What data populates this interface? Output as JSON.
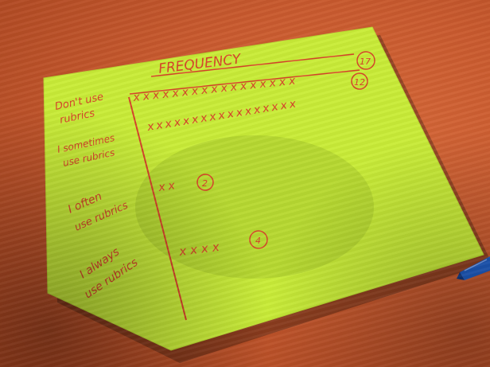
{
  "colors": {
    "table": "#c95a2e",
    "paper": "#c9ec38",
    "ink": "#d8432a",
    "pen": "#1f5fc8"
  },
  "sheet": {
    "header": "FREQUENCY",
    "rows": [
      {
        "label_line1": "Don't use",
        "label_line2": "rubrics",
        "marks": "xxxxxxxxxxxxxxxxx",
        "count": "17"
      },
      {
        "label_line1": "I sometimes",
        "label_line2": "use rubrics",
        "marks": "xxxxxxxxxxxxxxxxx",
        "count": "12"
      },
      {
        "label_line1": "I often",
        "label_line2": "use rubrics",
        "marks": "xx",
        "count": "2"
      },
      {
        "label_line1": "I always",
        "label_line2": "use rubrics",
        "marks": "xxxx",
        "count": "4"
      }
    ]
  }
}
